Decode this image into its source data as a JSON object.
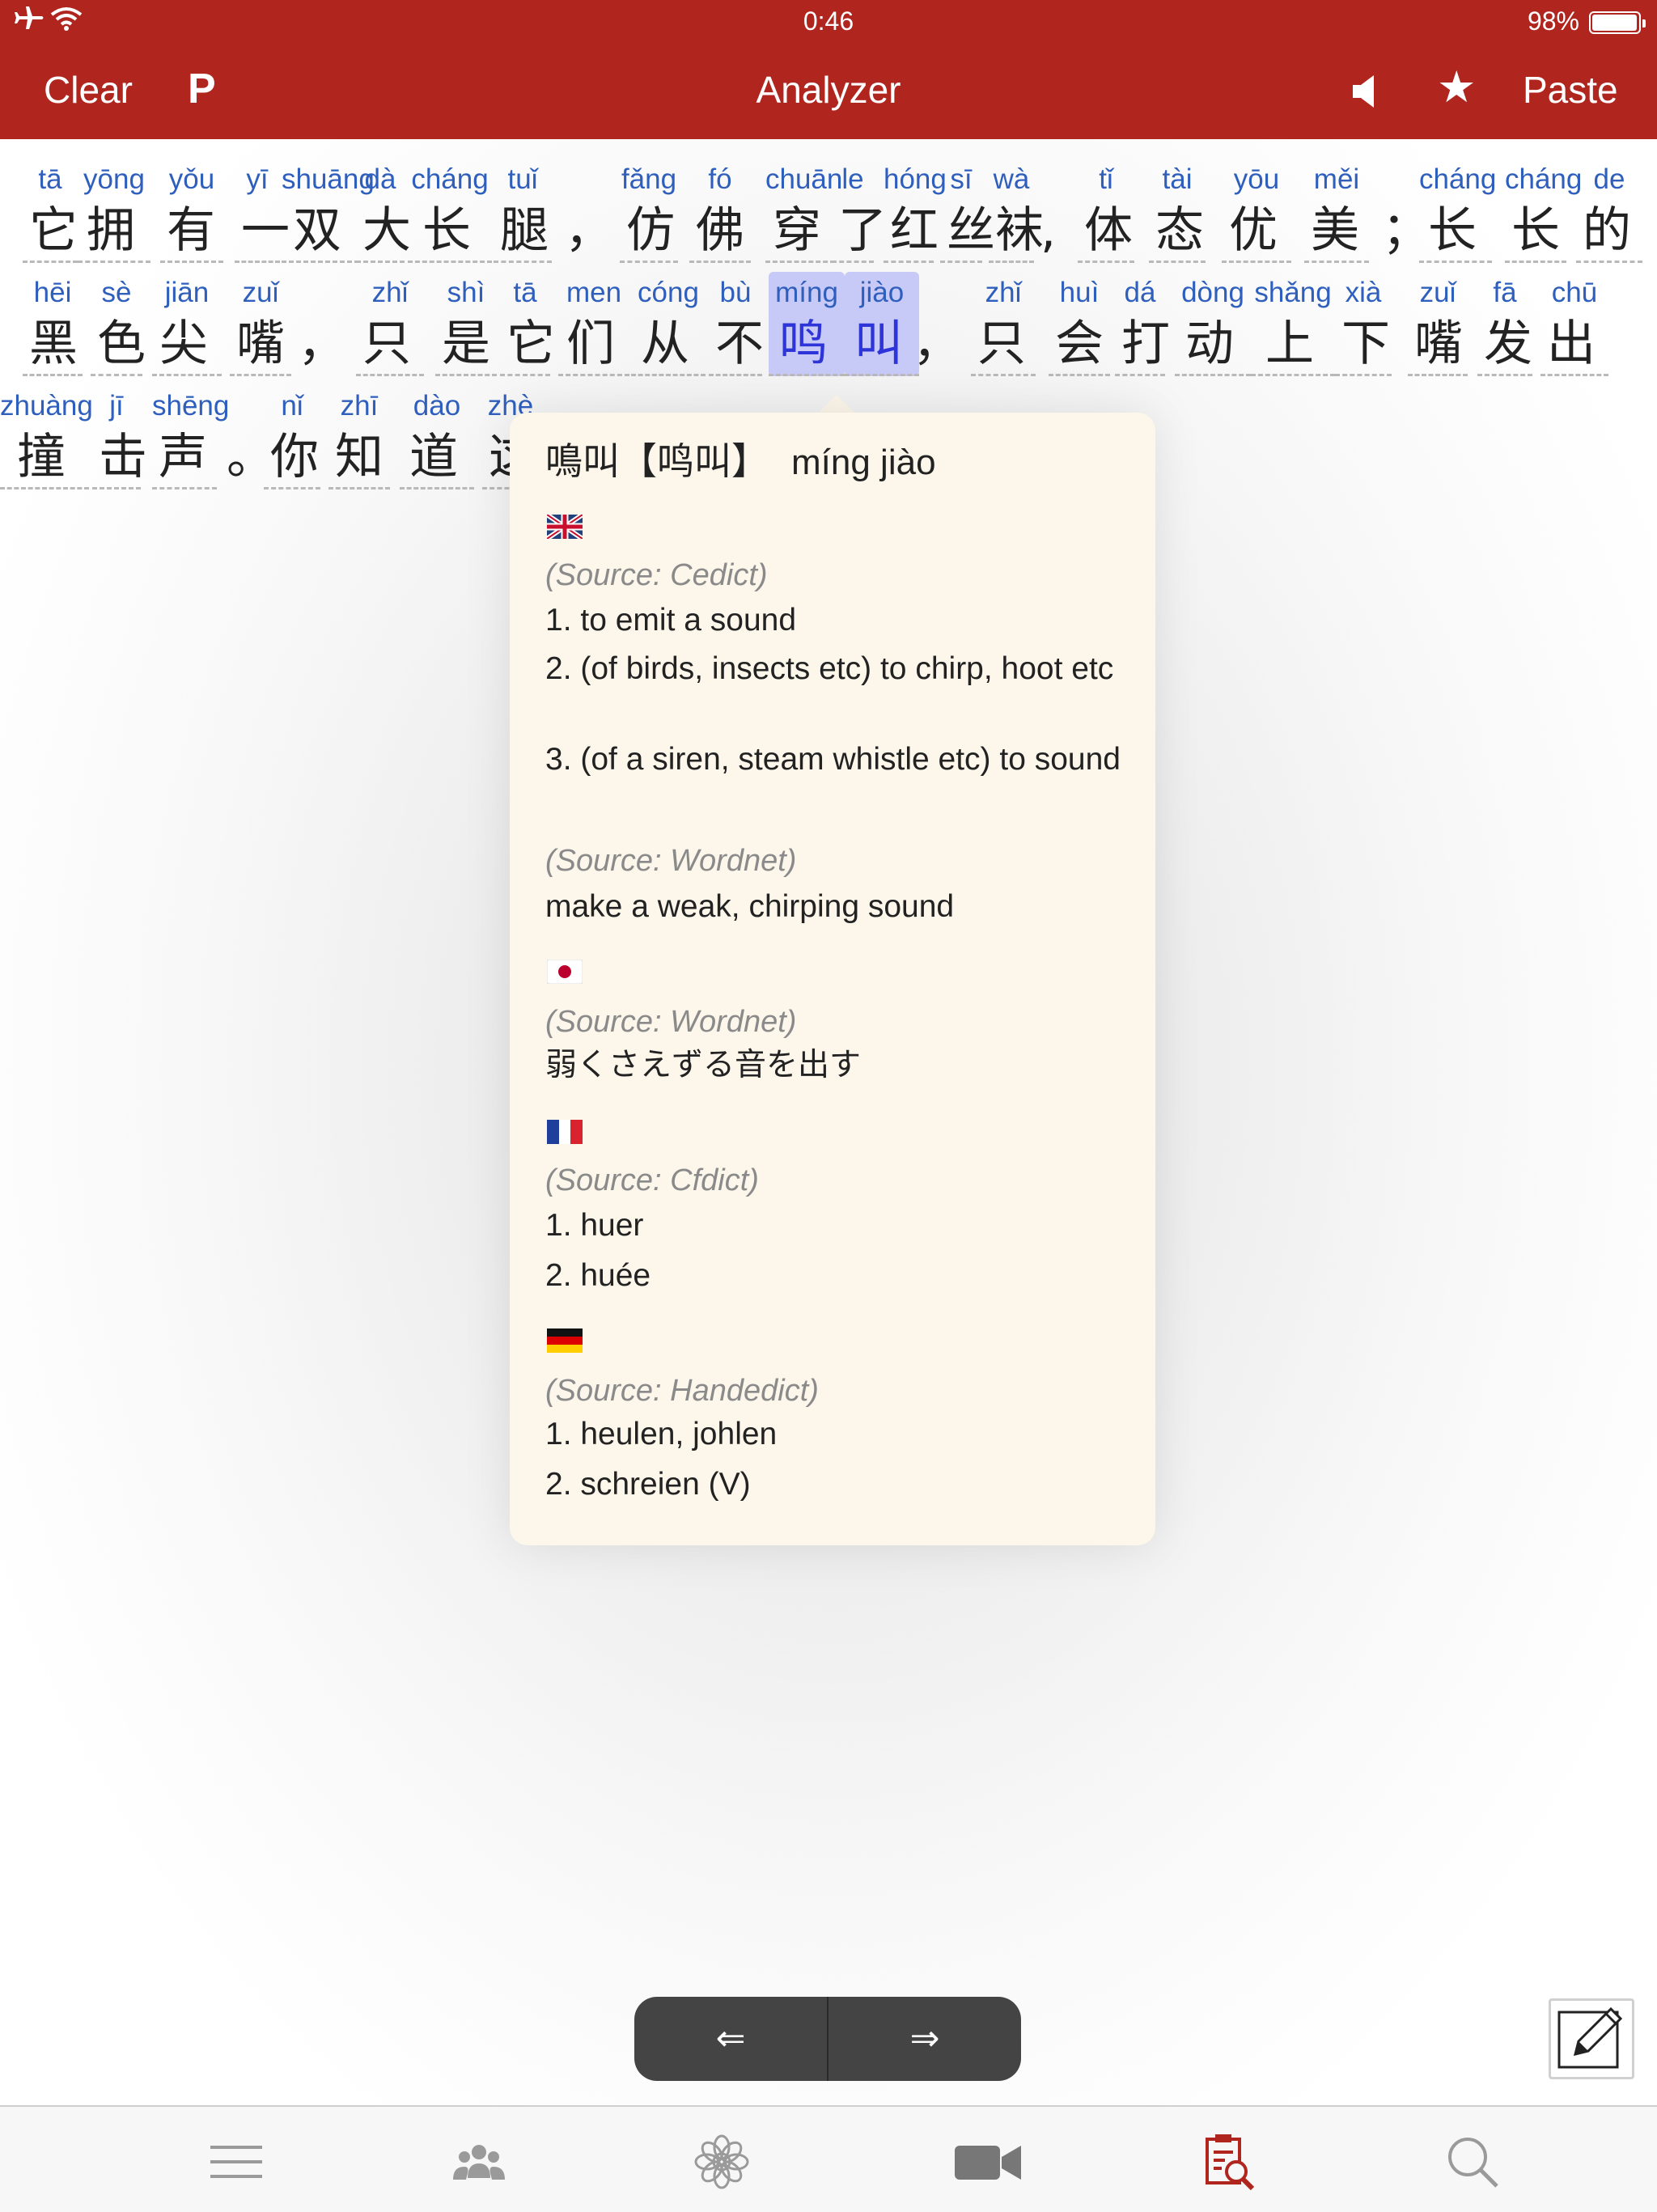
{
  "status": {
    "time": "0:46",
    "battery": "98%",
    "battery_level": 0.98
  },
  "navbar": {
    "clear": "Clear",
    "p_button": "P",
    "title": "Analyzer",
    "star": "★",
    "paste": "Paste"
  },
  "lines": [
    [
      {
        "py": "tā",
        "hz": "它"
      },
      {
        "py": "yōng",
        "hz": "拥"
      },
      {
        "py": "yǒu",
        "hz": "有"
      },
      {
        "py": "yī",
        "hz": "一"
      },
      {
        "py": "shuāng",
        "hz": "双"
      },
      {
        "py": "dà",
        "hz": "大"
      },
      {
        "py": "cháng",
        "hz": "长"
      },
      {
        "py": "tuǐ",
        "hz": "腿"
      },
      {
        "py": "",
        "hz": "，"
      },
      {
        "py": "fǎng",
        "hz": "仿"
      },
      {
        "py": "fó",
        "hz": "佛"
      },
      {
        "py": "chuān",
        "hz": "穿"
      },
      {
        "py": "le",
        "hz": "了"
      },
      {
        "py": "hóng",
        "hz": "红"
      },
      {
        "py": "sī",
        "hz": "丝"
      },
      {
        "py": "wà",
        "hz": "袜"
      },
      {
        "py": "",
        "hz": ","
      },
      {
        "py": "tǐ",
        "hz": "体"
      },
      {
        "py": "tài",
        "hz": "态"
      },
      {
        "py": "yōu",
        "hz": "优"
      },
      {
        "py": "měi",
        "hz": "美"
      },
      {
        "py": "",
        "hz": "；"
      },
      {
        "py": "cháng",
        "hz": "长"
      },
      {
        "py": "cháng",
        "hz": "长"
      },
      {
        "py": "de",
        "hz": "的"
      }
    ],
    [
      {
        "py": "hēi",
        "hz": "黑"
      },
      {
        "py": "sè",
        "hz": "色"
      },
      {
        "py": "jiān",
        "hz": "尖"
      },
      {
        "py": "zuǐ",
        "hz": "嘴"
      },
      {
        "py": "",
        "hz": "，"
      },
      {
        "py": "zhǐ",
        "hz": "只"
      },
      {
        "py": "shì",
        "hz": "是"
      },
      {
        "py": "tā",
        "hz": "它"
      },
      {
        "py": "men",
        "hz": "们"
      },
      {
        "py": "cóng",
        "hz": "从"
      },
      {
        "py": "bù",
        "hz": "不"
      },
      {
        "py": "míng",
        "hz": "鸣"
      },
      {
        "py": "jiào",
        "hz": "叫"
      },
      {
        "py": "",
        "hz": "，"
      },
      {
        "py": "zhǐ",
        "hz": "只"
      },
      {
        "py": "huì",
        "hz": "会"
      },
      {
        "py": "dá",
        "hz": "打"
      },
      {
        "py": "dòng",
        "hz": "动"
      },
      {
        "py": "shǎng",
        "hz": "上"
      },
      {
        "py": "xià",
        "hz": "下"
      },
      {
        "py": "zuǐ",
        "hz": "嘴"
      },
      {
        "py": "fā",
        "hz": "发"
      },
      {
        "py": "chū",
        "hz": "出"
      }
    ],
    [
      {
        "py": "zhuàng",
        "hz": "撞"
      },
      {
        "py": "jī",
        "hz": "击"
      },
      {
        "py": "shēng",
        "hz": "声"
      },
      {
        "py": "",
        "hz": "。"
      },
      {
        "py": "nǐ",
        "hz": "你"
      },
      {
        "py": "zhī",
        "hz": "知"
      },
      {
        "py": "dào",
        "hz": "道"
      },
      {
        "py": "zhè",
        "hz": "这"
      }
    ]
  ],
  "popover": {
    "headword": "鳴叫【鸣叫】",
    "pinyin": "míng jiào",
    "sections": [
      {
        "flag": "uk-flag-icon",
        "source": "(Source: Cedict)",
        "defs": [
          "1. to emit a sound",
          "2. (of birds, insects etc) to chirp, hoot etc",
          "3. (of a siren, steam whistle etc) to sound"
        ]
      },
      {
        "source": "(Source: Wordnet)",
        "defs": [
          "make a weak, chirping sound"
        ]
      },
      {
        "flag": "japan-flag-icon",
        "source": "(Source: Wordnet)",
        "defs": [
          "弱くさえずる音を出す"
        ]
      },
      {
        "flag": "france-flag-icon",
        "source": "(Source: Cfdict)",
        "defs": [
          "1. huer",
          "2. huée"
        ]
      },
      {
        "flag": "germany-flag-icon",
        "source": "(Source: Handedict)",
        "defs": [
          "1. heulen, johlen",
          "2. schreien (V)"
        ]
      }
    ]
  },
  "buttons": {
    "prev": "⇐",
    "next": "⇒"
  },
  "tabs": [
    {
      "icon": "menu-icon",
      "color": "#9a9a9a"
    },
    {
      "icon": "people-icon",
      "color": "#9a9a9a"
    },
    {
      "icon": "flower-icon",
      "color": "#9a9a9a"
    },
    {
      "icon": "video-camera-icon",
      "color": "#777777"
    },
    {
      "icon": "document-search-icon",
      "color": "#b0261f"
    },
    {
      "icon": "search-icon",
      "color": "#9a9a9a"
    }
  ],
  "colors": {
    "accent": "#b0261f",
    "pinyin": "#2f5fbd",
    "selected": "#2d35d8",
    "popover_bg": "#fdf6ea"
  }
}
